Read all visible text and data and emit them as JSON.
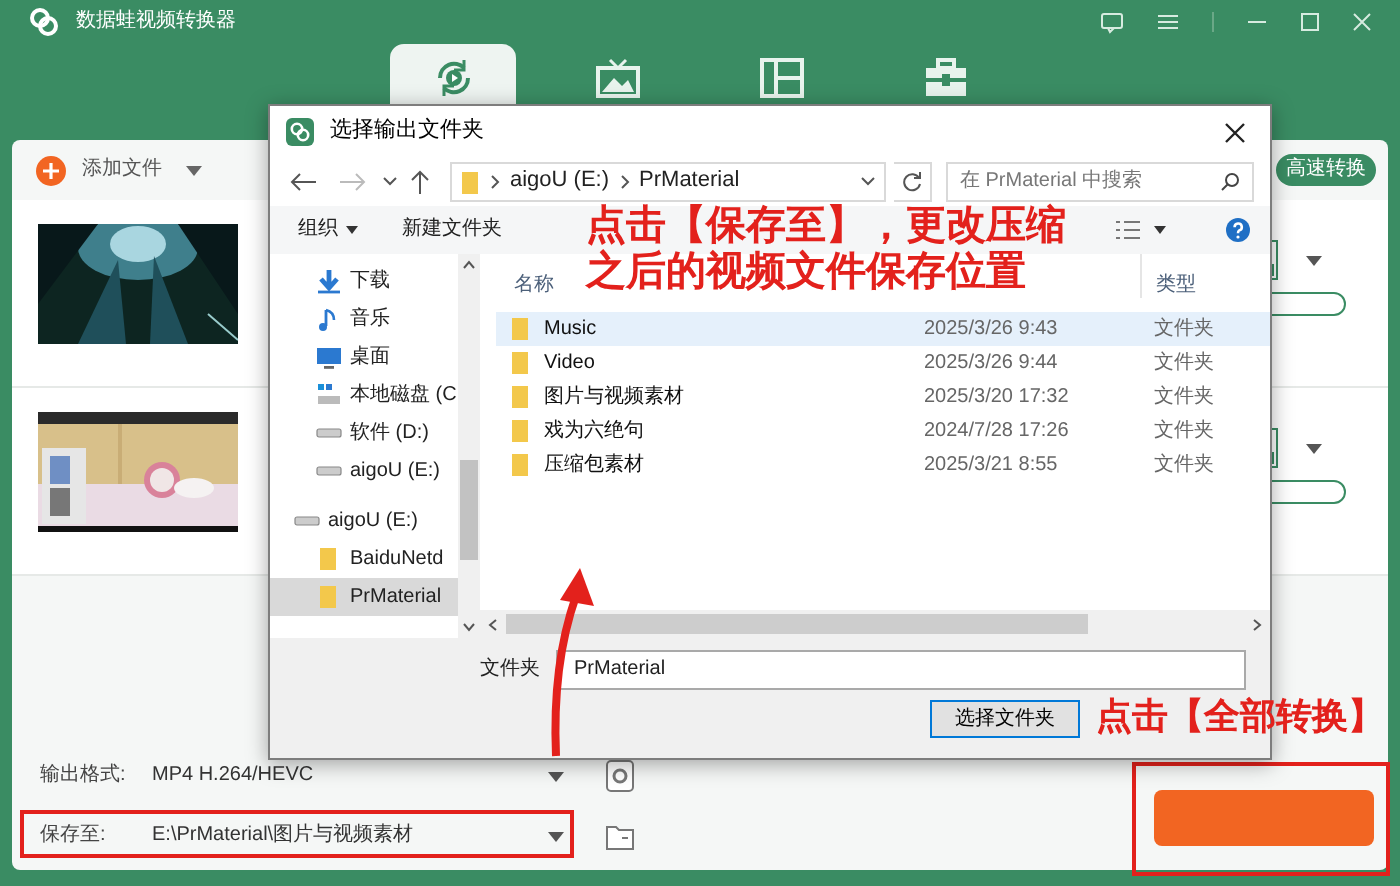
{
  "app": {
    "title": "数据蛙视频转换器",
    "tabs": [
      {
        "kind": "convert",
        "selected": true
      },
      {
        "kind": "picture",
        "selected": false
      },
      {
        "kind": "layout",
        "selected": false
      },
      {
        "kind": "toolbox",
        "selected": false
      }
    ],
    "add_file": "添加文件",
    "speed_button": "高速转换",
    "files": [
      {
        "kind": "forest"
      },
      {
        "kind": "room"
      }
    ],
    "output_format": {
      "label": "输出格式:",
      "value": "MP4 H.264/HEVC"
    },
    "save_to": {
      "label": "保存至:",
      "value": "E:\\PrMaterial\\图片与视频素材"
    }
  },
  "dialog": {
    "title": "选择输出文件夹",
    "path": [
      "aigoU (E:)",
      "PrMaterial"
    ],
    "search_placeholder": "在 PrMaterial 中搜索",
    "organize": "组织",
    "new_folder": "新建文件夹",
    "quick_access": [
      {
        "kind": "download",
        "label": "下载"
      },
      {
        "kind": "music",
        "label": "音乐"
      },
      {
        "kind": "desktop",
        "label": "桌面"
      },
      {
        "kind": "system-drive",
        "label": "本地磁盘 (C"
      },
      {
        "kind": "drive",
        "label": "软件 (D:)"
      },
      {
        "kind": "drive",
        "label": "aigoU (E:)"
      }
    ],
    "tree": [
      {
        "kind": "drive",
        "label": "aigoU (E:)",
        "selected": false,
        "children": [
          {
            "kind": "folder",
            "label": "BaiduNetd",
            "selected": false
          },
          {
            "kind": "folder",
            "label": "PrMaterial",
            "selected": true
          }
        ]
      }
    ],
    "columns": [
      "名称",
      "类型"
    ],
    "rows": [
      {
        "name": "Music",
        "date": "2025/3/26 9:43",
        "type": "文件夹",
        "selected": true
      },
      {
        "name": "Video",
        "date": "2025/3/26 9:44",
        "type": "文件夹",
        "selected": false
      },
      {
        "name": "图片与视频素材",
        "date": "2025/3/20 17:32",
        "type": "文件夹",
        "selected": false
      },
      {
        "name": "戏为六绝句",
        "date": "2024/7/28 17:26",
        "type": "文件夹",
        "selected": false
      },
      {
        "name": "压缩包素材",
        "date": "2025/3/21 8:55",
        "type": "文件夹",
        "selected": false
      }
    ],
    "folder_label": "文件夹",
    "folder_value": "PrMaterial",
    "select_button": "选择文件夹"
  },
  "annotations": [
    {
      "text": "点击【保存至】，更改压缩之后的视频文件保存位置"
    },
    {
      "text": "点击【全部转换】"
    }
  ]
}
